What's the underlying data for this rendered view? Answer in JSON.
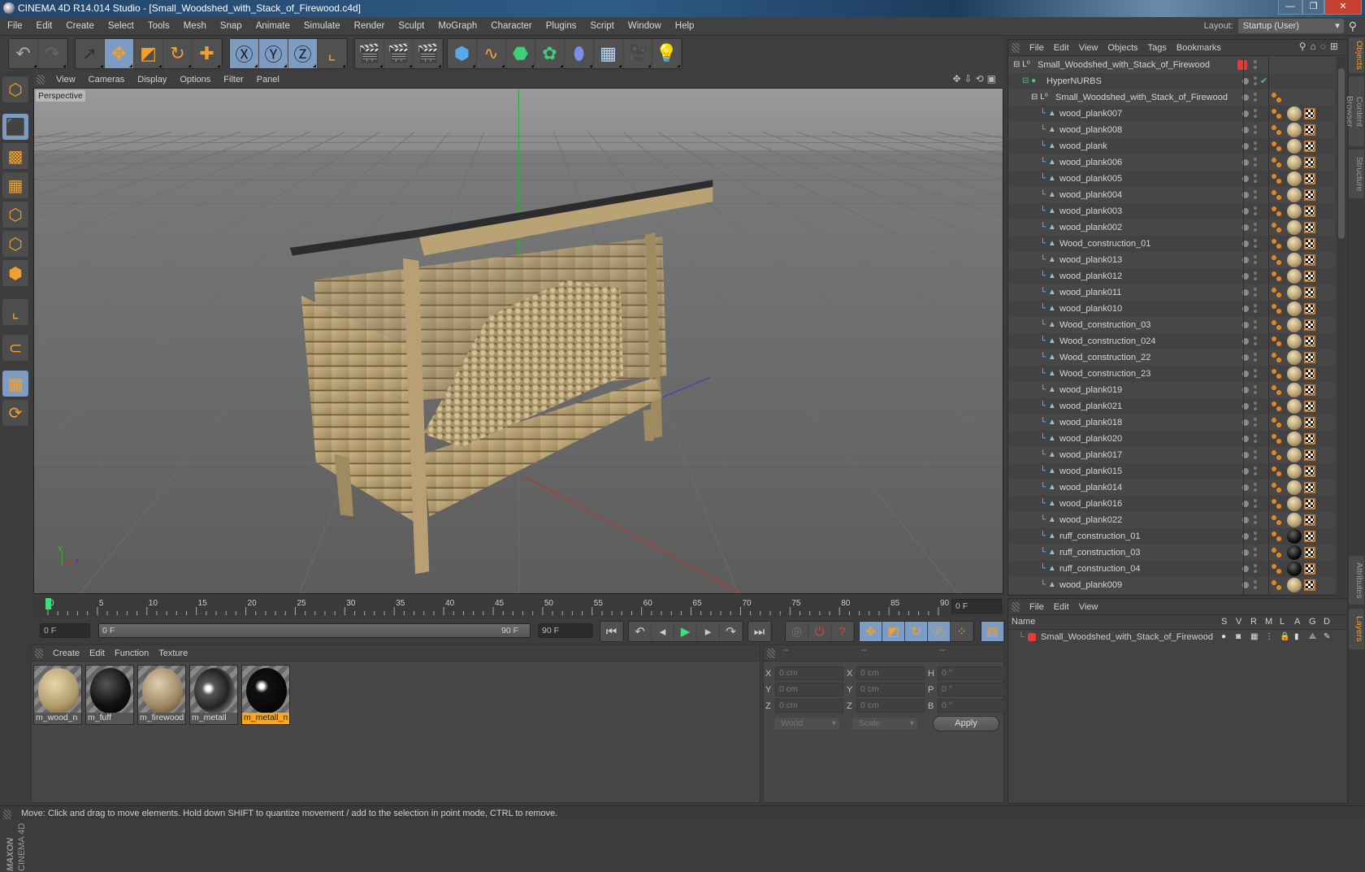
{
  "window": {
    "title": "CINEMA 4D R14.014 Studio - [Small_Woodshed_with_Stack_of_Firewood.c4d]",
    "buttons": [
      "minimize",
      "restore",
      "close"
    ]
  },
  "menu": [
    "File",
    "Edit",
    "Create",
    "Select",
    "Tools",
    "Mesh",
    "Snap",
    "Animate",
    "Simulate",
    "Render",
    "Sculpt",
    "MoGraph",
    "Character",
    "Plugins",
    "Script",
    "Window",
    "Help"
  ],
  "layout": {
    "label": "Layout:",
    "value": "Startup (User)"
  },
  "toolbar": {
    "groups": [
      [
        "undo-icon",
        "redo-icon"
      ],
      [
        "live-selection-icon",
        "move-icon",
        "scale-icon",
        "rotate-icon",
        "add-icon"
      ],
      [
        "x-axis-icon",
        "y-axis-icon",
        "z-axis-icon",
        "coordinate-system-icon"
      ],
      [
        "render-view-icon",
        "render-picture-viewer-icon",
        "render-settings-icon"
      ],
      [
        "cube-icon",
        "spline-icon",
        "nurbs-icon",
        "array-icon",
        "deformer-icon",
        "floor-icon",
        "camera-icon",
        "light-icon"
      ]
    ]
  },
  "lefttools": [
    "model-mode-icon",
    "object-mode-icon",
    "texture-mode-icon",
    "workplane-icon",
    "points-mode-icon",
    "edges-mode-icon",
    "polygons-mode-icon",
    "axis-mode-icon",
    "magnet-icon",
    "snap-grid-icon",
    "tweak-icon"
  ],
  "viewport": {
    "menu": [
      "View",
      "Cameras",
      "Display",
      "Options",
      "Filter",
      "Panel"
    ],
    "label": "Perspective"
  },
  "timeline": {
    "start": 0,
    "end": 90,
    "step": 5,
    "current_frame": "0 F"
  },
  "transport": {
    "start_field": "0 F",
    "range_start": "0 F",
    "range_end": "90 F",
    "end_field": "90 F"
  },
  "materials": {
    "menu": [
      "Create",
      "Edit",
      "Function",
      "Texture"
    ],
    "items": [
      {
        "name": "m_wood_n",
        "kind": "wood",
        "selected": false
      },
      {
        "name": "m_fuff",
        "kind": "black",
        "selected": false
      },
      {
        "name": "m_firewood",
        "kind": "firewood",
        "selected": false
      },
      {
        "name": "m_metall",
        "kind": "chrome",
        "selected": false
      },
      {
        "name": "m_metall_n",
        "kind": "glossy-black",
        "selected": true
      }
    ]
  },
  "coords": {
    "headers": [
      "--",
      "--",
      "--"
    ],
    "rows": [
      {
        "l1": "X",
        "v1": "0 cm",
        "l2": "X",
        "v2": "0 cm",
        "l3": "H",
        "v3": "0 °"
      },
      {
        "l1": "Y",
        "v1": "0 cm",
        "l2": "Y",
        "v2": "0 cm",
        "l3": "P",
        "v3": "0 °"
      },
      {
        "l1": "Z",
        "v1": "0 cm",
        "l2": "Z",
        "v2": "0 cm",
        "l3": "B",
        "v3": "0 °"
      }
    ],
    "mode": "World",
    "transform": "Scale",
    "apply": "Apply"
  },
  "objects": {
    "menu": [
      "File",
      "Edit",
      "View",
      "Objects",
      "Tags",
      "Bookmarks"
    ],
    "items": [
      {
        "name": "Small_Woodshed_with_Stack_of_Firewood",
        "level": 0,
        "type": "null",
        "layer_color": "#e83a3a"
      },
      {
        "name": "HyperNURBS",
        "level": 1,
        "type": "hypernurbs",
        "enabled": true
      },
      {
        "name": "Small_Woodshed_with_Stack_of_Firewood",
        "level": 2,
        "type": "null",
        "tags": [
          "phong"
        ]
      },
      {
        "name": "wood_plank007",
        "level": 3,
        "mat": "wood"
      },
      {
        "name": "wood_plank008",
        "level": 3,
        "mat": "wood"
      },
      {
        "name": "wood_plank",
        "level": 3,
        "mat": "wood"
      },
      {
        "name": "wood_plank006",
        "level": 3,
        "mat": "wood"
      },
      {
        "name": "wood_plank005",
        "level": 3,
        "mat": "wood"
      },
      {
        "name": "wood_plank004",
        "level": 3,
        "mat": "wood"
      },
      {
        "name": "wood_plank003",
        "level": 3,
        "mat": "wood"
      },
      {
        "name": "wood_plank002",
        "level": 3,
        "mat": "wood"
      },
      {
        "name": "Wood_construction_01",
        "level": 3,
        "mat": "wood"
      },
      {
        "name": "wood_plank013",
        "level": 3,
        "mat": "wood"
      },
      {
        "name": "wood_plank012",
        "level": 3,
        "mat": "wood"
      },
      {
        "name": "wood_plank011",
        "level": 3,
        "mat": "wood"
      },
      {
        "name": "wood_plank010",
        "level": 3,
        "mat": "wood"
      },
      {
        "name": "Wood_construction_03",
        "level": 3,
        "mat": "wood"
      },
      {
        "name": "Wood_construction_024",
        "level": 3,
        "mat": "wood"
      },
      {
        "name": "Wood_construction_22",
        "level": 3,
        "mat": "wood"
      },
      {
        "name": "Wood_construction_23",
        "level": 3,
        "mat": "wood"
      },
      {
        "name": "wood_plank019",
        "level": 3,
        "mat": "wood"
      },
      {
        "name": "wood_plank021",
        "level": 3,
        "mat": "wood"
      },
      {
        "name": "wood_plank018",
        "level": 3,
        "mat": "wood"
      },
      {
        "name": "wood_plank020",
        "level": 3,
        "mat": "wood"
      },
      {
        "name": "wood_plank017",
        "level": 3,
        "mat": "wood"
      },
      {
        "name": "wood_plank015",
        "level": 3,
        "mat": "wood"
      },
      {
        "name": "wood_plank014",
        "level": 3,
        "mat": "wood"
      },
      {
        "name": "wood_plank016",
        "level": 3,
        "mat": "wood"
      },
      {
        "name": "wood_plank022",
        "level": 3,
        "mat": "wood"
      },
      {
        "name": "ruff_construction_01",
        "level": 3,
        "mat": "black"
      },
      {
        "name": "ruff_construction_03",
        "level": 3,
        "mat": "black"
      },
      {
        "name": "ruff_construction_04",
        "level": 3,
        "mat": "black"
      },
      {
        "name": "wood_plank009",
        "level": 3,
        "mat": "wood"
      }
    ]
  },
  "layers": {
    "menu": [
      "File",
      "Edit",
      "View"
    ],
    "columns": [
      "Name",
      "S",
      "V",
      "R",
      "M",
      "L",
      "A",
      "G",
      "D"
    ],
    "items": [
      {
        "name": "Small_Woodshed_with_Stack_of_Firewood",
        "color": "#e83a3a"
      }
    ]
  },
  "righttabs": [
    {
      "label": "Objects",
      "active": true
    },
    {
      "label": "Content Browser",
      "active": false
    },
    {
      "label": "Structure",
      "active": false
    },
    {
      "label": "Attributes",
      "active": false
    },
    {
      "label": "Layers",
      "active": true
    }
  ],
  "status": "Move: Click and drag to move elements. Hold down SHIFT to quantize movement / add to the selection in point mode, CTRL to remove.",
  "logo": "MAXON CINEMA 4D",
  "colors": {
    "accent": "#7d9cc4",
    "selection": "#f5a623",
    "play": "#3de07a"
  }
}
